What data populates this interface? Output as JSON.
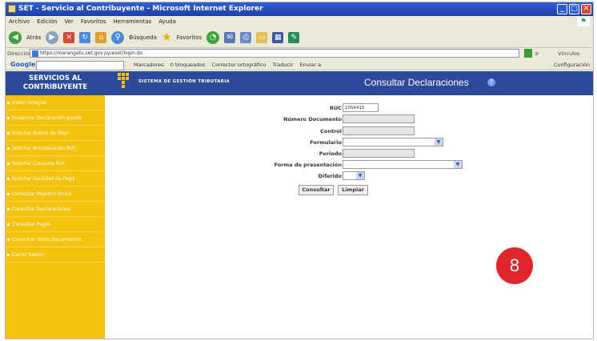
{
  "window": {
    "title": "SET - Servicio al Contribuyente - Microsoft Internet Explorer",
    "minimize": "_",
    "maximize": "□",
    "close": "✕"
  },
  "menubar": {
    "items": [
      "Archivo",
      "Edición",
      "Ver",
      "Favoritos",
      "Herramientas",
      "Ayuda"
    ]
  },
  "toolbar": {
    "back_label": "Atrás",
    "search_label": "Búsqueda",
    "favorites_label": "Favoritos"
  },
  "addressbar": {
    "label": "Dirección",
    "url": "https://marangatu.set.gov.py/eset/login.do",
    "go_label": "Ir",
    "links_label": "Vínculos"
  },
  "googlebar": {
    "logo": "Google",
    "items": [
      "Marcadores",
      "0 bloqueados",
      "Corrector ortográfico",
      "Traducir",
      "Enviar a"
    ],
    "config_label": "Configuración"
  },
  "sidebar": {
    "header": "SERVICIOS AL CONTRIBUYENTE",
    "items": [
      {
        "label": "Visión Integral"
      },
      {
        "label": "Presentar Declaración Jurada"
      },
      {
        "label": "Solicitar Boleta de Pago"
      },
      {
        "label": "Solicitar Actualización RUC"
      },
      {
        "label": "Solicitar Clausura RUC"
      },
      {
        "label": "Solicitar Facilidad de Pago"
      },
      {
        "label": "Consultar Registro Único"
      },
      {
        "label": "Consultar Declaraciones"
      },
      {
        "label": "Consultar Pagos"
      },
      {
        "label": "Consultar Otros Documentos"
      },
      {
        "label": "Cerrar Sesión"
      }
    ]
  },
  "header": {
    "system_name": "SISTEMA DE GESTIÓN TRIBUTARIA",
    "title": "Consultar Declaraciones"
  },
  "form": {
    "ruc_label": "RUC",
    "ruc_value": "1054415",
    "numero_documento_label": "Número Documento",
    "control_label": "Control",
    "formulario_label": "Formulario",
    "periodo_label": "Periodo",
    "forma_presentacion_label": "Forma de presentación",
    "diferido_label": "Diferido",
    "consultar_label": "Consultar",
    "limpiar_label": "Limpiar"
  },
  "badge": {
    "number": "8"
  },
  "colors": {
    "header_blue": "#2d4a9a",
    "sidebar_yellow": "#f4c20d",
    "badge_red": "#e1262b"
  }
}
